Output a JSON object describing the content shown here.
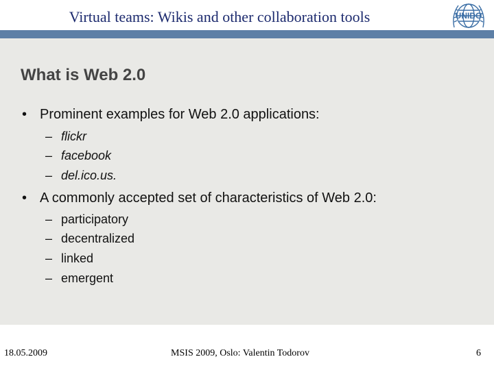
{
  "header": {
    "title": "Virtual teams: Wikis and other collaboration tools",
    "logo_text": "UNIDO"
  },
  "slide": {
    "heading": "What is Web 2.0",
    "bullets": [
      {
        "text": "Prominent examples for Web 2.0 applications:",
        "sub_items": [
          "flickr",
          "facebook",
          "del.ico.us."
        ]
      },
      {
        "text": "A commonly accepted set of characteristics of Web 2.0:",
        "sub_items": [
          "participatory",
          "decentralized",
          "linked",
          "emergent"
        ]
      }
    ]
  },
  "footer": {
    "date": "18.05.2009",
    "center": "MSIS 2009, Oslo: Valentin Todorov",
    "page_number": "6"
  },
  "glyphs": {
    "bullet": "•",
    "dash": "–"
  },
  "colors": {
    "header_bar": "#5d7fa6",
    "content_background": "#e9e9e6",
    "title_text": "#1c2a6e",
    "heading_text": "#444444"
  }
}
